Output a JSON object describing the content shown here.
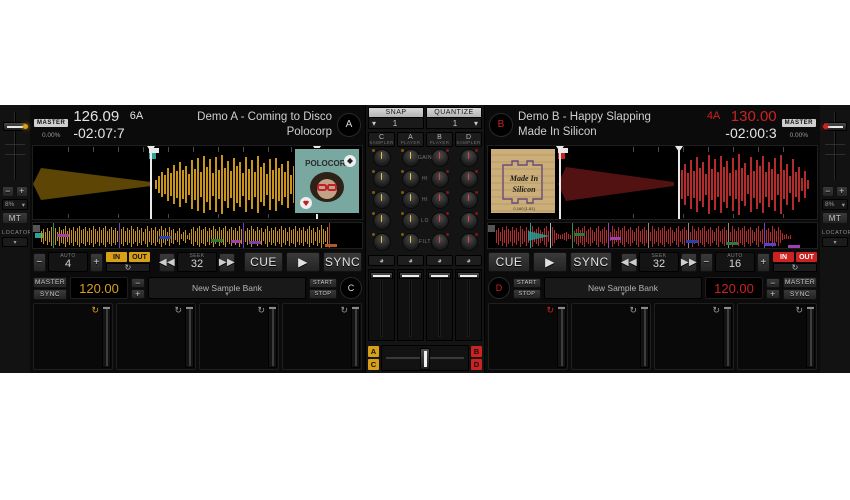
{
  "decks": {
    "a": {
      "master_label": "MASTER",
      "pitch_pct": "0.00%",
      "bpm": "126.09",
      "key": "6A",
      "time": "-02:07:7",
      "title": "Demo A - Coming to Disco",
      "artist": "Polocorp",
      "badge": "A",
      "art_text": "POLOCORP",
      "pitch_range": "8%",
      "mt_label": "MT",
      "locators_label": "LOCATORS",
      "auto_label": "AUTO",
      "auto_value": "4",
      "seek_label": "SEEK",
      "seek_value": "32",
      "loop_in": "IN",
      "loop_out": "OUT",
      "cue_label": "CUE",
      "play_label": "▶",
      "sync_label": "SYNC",
      "minus": "−",
      "plus": "+",
      "accent": "#d8a017"
    },
    "b": {
      "master_label": "MASTER",
      "pitch_pct": "0.00%",
      "bpm": "130.00",
      "key": "4A",
      "time": "-02:00:3",
      "title": "Demo B - Happy Slapping",
      "artist": "Made In Silicon",
      "badge": "B",
      "art_text": "Made In Silicon",
      "art_subtext": "0.160 [1.81]",
      "pitch_range": "8%",
      "mt_label": "MT",
      "locators_label": "LOCATORS",
      "auto_label": "AUTO",
      "auto_value": "16",
      "seek_label": "SEEK",
      "seek_value": "32",
      "loop_in": "IN",
      "loop_out": "OUT",
      "cue_label": "CUE",
      "play_label": "▶",
      "sync_label": "SYNC",
      "minus": "−",
      "plus": "+",
      "accent": "#cc2222"
    }
  },
  "samplers": {
    "c": {
      "badge": "C",
      "master_label": "MASTER",
      "sync_label": "SYNC",
      "bpm": "120.00",
      "bank_name": "New Sample Bank",
      "start_label": "START",
      "stop_label": "STOP",
      "minus": "−",
      "plus": "+",
      "accent": "#d8a017",
      "pads": [
        {
          "loop": "↻"
        },
        {
          "loop": "↻"
        },
        {
          "loop": "↻"
        },
        {
          "loop": "↻"
        }
      ]
    },
    "d": {
      "badge": "D",
      "master_label": "MASTER",
      "sync_label": "SYNC",
      "bpm": "120.00",
      "bank_name": "New Sample Bank",
      "start_label": "START",
      "stop_label": "STOP",
      "minus": "−",
      "plus": "+",
      "accent": "#cc2222",
      "pads": [
        {
          "loop": "↻"
        },
        {
          "loop": "↻"
        },
        {
          "loop": "↻"
        },
        {
          "loop": "↻"
        }
      ]
    }
  },
  "mixer": {
    "snap_label": "SNAP",
    "snap_value": "1",
    "quantize_label": "QUANTIZE",
    "quantize_value": "1",
    "channels": [
      {
        "name": "C",
        "role": "SAMPLER",
        "accent": "#d8a017"
      },
      {
        "name": "A",
        "role": "PLAYER",
        "accent": "#d8a017"
      },
      {
        "name": "B",
        "role": "PLAYER",
        "accent": "#cc2222"
      },
      {
        "name": "D",
        "role": "SAMPLER",
        "accent": "#cc2222"
      }
    ],
    "knob_rows": [
      "GAIN",
      "HI",
      "MID",
      "LO",
      "FILT"
    ],
    "cue_icon": "♪",
    "crossfader": {
      "assign_left_top": "A",
      "assign_left_bottom": "C",
      "assign_right_top": "B",
      "assign_right_bottom": "D"
    }
  },
  "colors": {
    "gold": "#d8a017",
    "red": "#cc2222",
    "wave_gold": "#c8941a",
    "wave_red": "#b52a2a",
    "panel": "#141414"
  }
}
